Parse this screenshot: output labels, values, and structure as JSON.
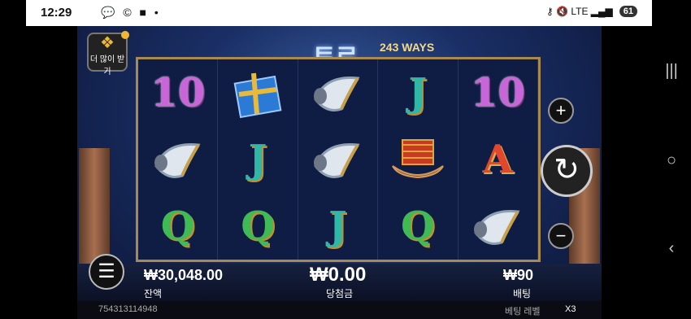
{
  "status": {
    "time": "12:29",
    "icons_left": "💬 © ■ •",
    "icons_right": "⚷ 🔇 LTE ▂▄▆",
    "battery": "61"
  },
  "game": {
    "title": "토르",
    "ways": "243 WAYS",
    "more_button_label": "더 많이 받기",
    "reels": [
      [
        "10",
        "gift-box",
        "drinking-horn",
        "J",
        "10"
      ],
      [
        "drinking-horn",
        "J",
        "drinking-horn",
        "viking-ship",
        "A"
      ],
      [
        "Q",
        "Q",
        "J",
        "Q",
        "drinking-horn"
      ]
    ],
    "balance": {
      "value": "₩30,048.00",
      "label": "잔액"
    },
    "win": {
      "value": "₩0.00",
      "label": "당첨금"
    },
    "bet": {
      "value": "₩90",
      "label": "배팅"
    },
    "session_id": "754313114948",
    "bet_level": {
      "label": "베팅 레벨",
      "value": "X3"
    }
  },
  "colors": {
    "frame": "#a8894f",
    "panel": "#0f1d44"
  }
}
